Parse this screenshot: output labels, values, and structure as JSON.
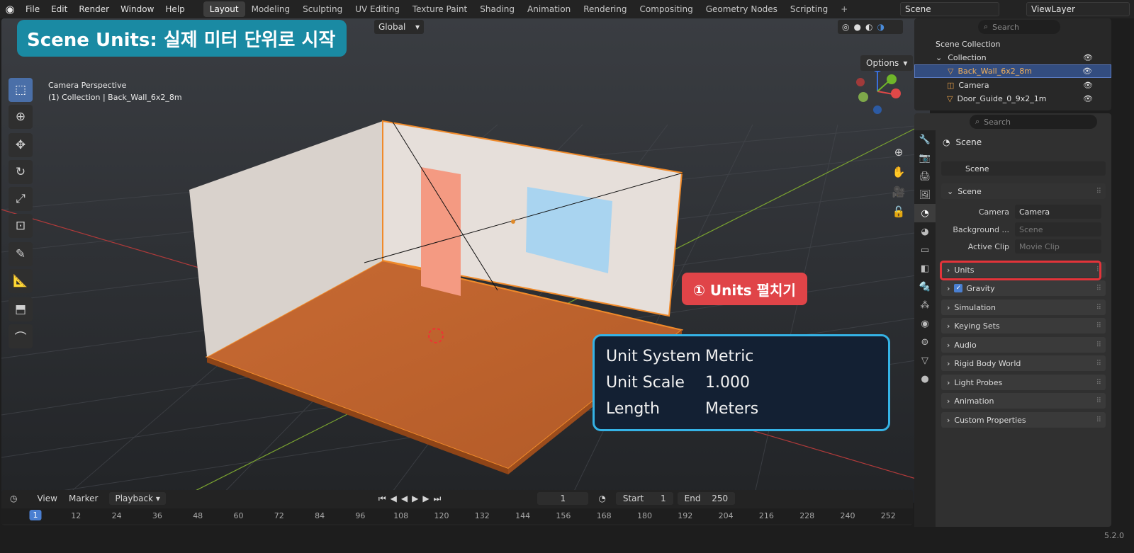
{
  "topbar": {
    "menu": [
      "File",
      "Edit",
      "Render",
      "Window",
      "Help"
    ],
    "workspaces": [
      "Layout",
      "Modeling",
      "Sculpting",
      "UV Editing",
      "Texture Paint",
      "Shading",
      "Animation",
      "Rendering",
      "Compositing",
      "Geometry Nodes",
      "Scripting"
    ],
    "active_workspace": "Layout",
    "scene": "Scene",
    "view_layer": "ViewLayer"
  },
  "viewport": {
    "transform_orientation": "Global",
    "options_label": "Options",
    "camera_label": "Camera Perspective",
    "collection_label": "(1) Collection | Back_Wall_6x2_8m"
  },
  "overlay": {
    "title": "Scene Units: 실제 미터 단위로 시작",
    "step_callout": "① Units 펼치기",
    "unit_system_key": "Unit System",
    "unit_system_val": "Metric",
    "unit_scale_key": "Unit Scale",
    "unit_scale_val": "1.000",
    "length_key": "Length",
    "length_val": "Meters"
  },
  "outliner": {
    "search_placeholder": "Search",
    "root": "Scene Collection",
    "collection": "Collection",
    "items": [
      "Back_Wall_6x2_8m",
      "Camera",
      "Door_Guide_0_9x2_1m"
    ]
  },
  "properties": {
    "search_placeholder": "Search",
    "header": "Scene",
    "scene_selector": "Scene",
    "scene_panel": "Scene",
    "camera_label": "Camera",
    "camera_value": "Camera",
    "background_label": "Background ...",
    "background_value": "Scene",
    "active_clip_label": "Active Clip",
    "active_clip_value": "Movie Clip",
    "panels": [
      "Units",
      "Gravity",
      "Simulation",
      "Keying Sets",
      "Audio",
      "Rigid Body World",
      "Light Probes",
      "Animation",
      "Custom Properties"
    ]
  },
  "timeline": {
    "view": "View",
    "marker": "Marker",
    "playback": "Playback",
    "current_frame": "1",
    "start_label": "Start",
    "start_value": "1",
    "end_label": "End",
    "end_value": "250",
    "ticks": [
      "1",
      "12",
      "24",
      "36",
      "48",
      "60",
      "72",
      "84",
      "96",
      "108",
      "120",
      "132",
      "144",
      "156",
      "168",
      "180",
      "192",
      "204",
      "216",
      "228",
      "240",
      "252"
    ]
  },
  "status": {
    "version": "5.2.0"
  }
}
